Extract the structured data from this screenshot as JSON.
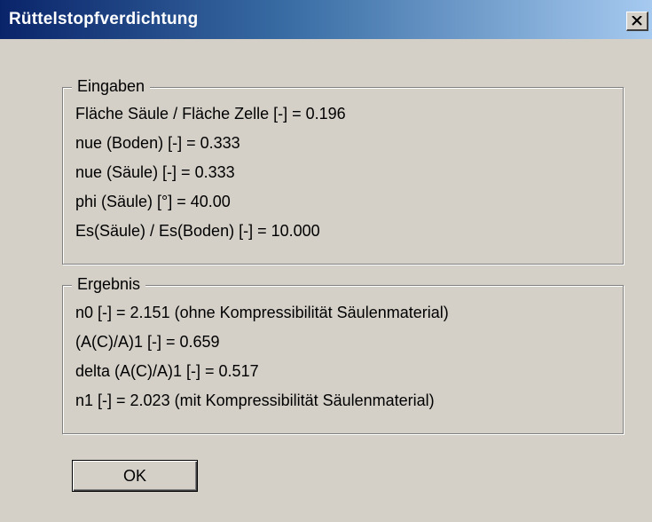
{
  "window": {
    "title": "Rüttelstopfverdichtung",
    "close_icon": "close-icon"
  },
  "inputs_group": {
    "legend": "Eingaben",
    "lines": [
      "Fläche Säule / Fläche Zelle [-] = 0.196",
      "nue (Boden) [-] = 0.333",
      "nue (Säule) [-] = 0.333",
      "phi (Säule) [°] = 40.00",
      "Es(Säule) / Es(Boden) [-] = 10.000"
    ]
  },
  "results_group": {
    "legend": "Ergebnis",
    "lines": [
      "n0 [-] = 2.151 (ohne Kompressibilität Säulenmaterial)",
      "(A(C)/A)1 [-] = 0.659",
      "delta (A(C)/A)1 [-] = 0.517",
      "n1 [-] = 2.023 (mit Kompressibilität Säulenmaterial)"
    ]
  },
  "buttons": {
    "ok_label": "OK"
  }
}
